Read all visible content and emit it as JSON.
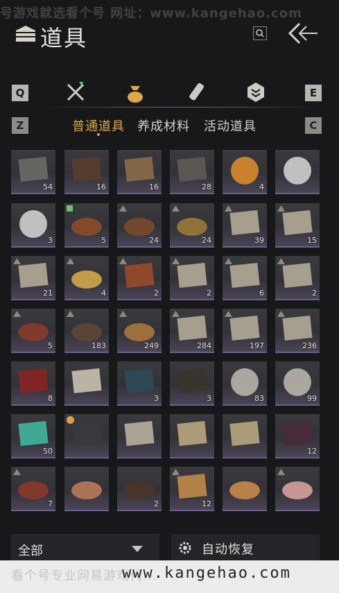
{
  "watermark": {
    "top": "号游戏就选看个号  网址：www.kangehao.com",
    "bottom_left": "看个号专业网易游戏代...",
    "url": "www.kangehao.com"
  },
  "header": {
    "title": "道具"
  },
  "category_bar": {
    "left_key": "Q",
    "right_key": "E",
    "icons": [
      "crossed-swords-icon",
      "pouch-icon",
      "scroll-icon",
      "badge-icon"
    ],
    "active_index": 1,
    "accent": "#e0a64a"
  },
  "subtabs": {
    "left_key": "Z",
    "right_key": "C",
    "items": [
      "普通道具",
      "养成材料",
      "活动道具"
    ],
    "active_index": 0
  },
  "items": [
    {
      "icon": "chest-open-icon",
      "count": "54"
    },
    {
      "icon": "wooden-cabinet-icon",
      "count": "16"
    },
    {
      "icon": "open-box-icon",
      "count": "16"
    },
    {
      "icon": "iron-chest-icon",
      "count": "28"
    },
    {
      "icon": "golden-orb-icon",
      "count": "4"
    },
    {
      "icon": "sect-emblem-icon",
      "count": ""
    },
    {
      "icon": "mountain-emblem-icon",
      "count": "3"
    },
    {
      "icon": "stew-pot-icon",
      "count": "5",
      "badge": "green"
    },
    {
      "icon": "meat-bowl-icon",
      "count": "24",
      "badge": "up"
    },
    {
      "icon": "dumpling-plate-icon",
      "count": "24",
      "badge": "up"
    },
    {
      "icon": "recipe-scroll-icon",
      "count": "39",
      "badge": "up"
    },
    {
      "icon": "recipe-scroll-icon",
      "count": "15",
      "badge": "up"
    },
    {
      "icon": "recipe-scroll-icon",
      "count": "21",
      "badge": "up"
    },
    {
      "icon": "noodle-plate-icon",
      "count": "4",
      "badge": "up"
    },
    {
      "icon": "roast-leg-icon",
      "count": "2",
      "badge": "up"
    },
    {
      "icon": "recipe-scroll-icon",
      "count": "2",
      "badge": "up"
    },
    {
      "icon": "recipe-scroll-icon",
      "count": "6",
      "badge": "up"
    },
    {
      "icon": "recipe-scroll-icon",
      "count": "2",
      "badge": "up"
    },
    {
      "icon": "stew-bowl-icon",
      "count": "5",
      "badge": "up"
    },
    {
      "icon": "clay-pot-icon",
      "count": "183",
      "badge": "up"
    },
    {
      "icon": "fried-dish-icon",
      "count": "249",
      "badge": "up"
    },
    {
      "icon": "recipe-scroll-icon",
      "count": "284",
      "badge": "up"
    },
    {
      "icon": "recipe-scroll-icon",
      "count": "197",
      "badge": "up"
    },
    {
      "icon": "recipe-scroll-icon",
      "count": "236",
      "badge": "up"
    },
    {
      "icon": "wine-jar-icon",
      "count": "8"
    },
    {
      "icon": "letter-paper-icon",
      "count": ""
    },
    {
      "icon": "gift-box-icon",
      "count": "3"
    },
    {
      "icon": "hanging-banner-icon",
      "count": "3"
    },
    {
      "icon": "bird-token-icon",
      "count": "83"
    },
    {
      "icon": "bird-token-icon",
      "count": "99"
    },
    {
      "icon": "jade-stone-icon",
      "count": "50"
    },
    {
      "icon": "dark-book-icon",
      "count": "",
      "badge": "clock"
    },
    {
      "icon": "open-notes-icon",
      "count": ""
    },
    {
      "icon": "map-scroll-icon",
      "count": ""
    },
    {
      "icon": "map-scroll-icon",
      "count": ""
    },
    {
      "icon": "horn-icon",
      "count": "12"
    },
    {
      "icon": "sliced-meat-icon",
      "count": "7",
      "badge": "up"
    },
    {
      "icon": "pastry-plate-icon",
      "count": ""
    },
    {
      "icon": "dark-dumplings-icon",
      "count": "2"
    },
    {
      "icon": "square-cake-icon",
      "count": "12",
      "badge": "up"
    },
    {
      "icon": "pie-plate-icon",
      "count": ""
    },
    {
      "icon": "sashimi-plate-icon",
      "count": "",
      "badge": "up"
    }
  ],
  "footer": {
    "filter_label": "全部",
    "auto_recover_label": "自动恢复"
  }
}
